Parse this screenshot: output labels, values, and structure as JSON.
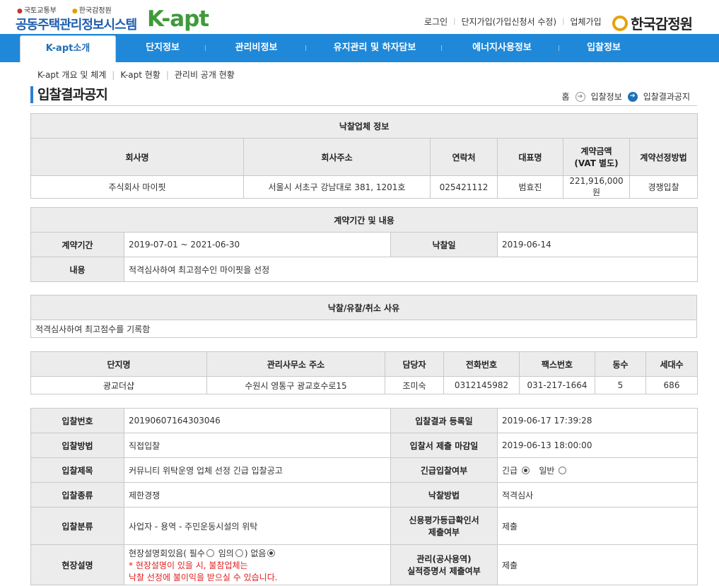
{
  "header": {
    "gov_logo1": "국토교통부",
    "gov_logo2": "한국감정원",
    "system_title": "공동주택관리정보시스템",
    "brand": "K-apt",
    "util_links": [
      "로그인",
      "단지가입(가입신청서 수정)",
      "업체가입"
    ],
    "agency": "한국감정원"
  },
  "nav": {
    "items": [
      "K-apt소개",
      "단지정보",
      "관리비정보",
      "유지관리 및 하자담보",
      "에너지사용정보",
      "입찰정보"
    ]
  },
  "subnav": [
    "K-apt 개요 및 체계",
    "K-apt 현황",
    "관리비 공개 현황"
  ],
  "page": {
    "title": "입찰결과공지",
    "breadcrumb": [
      "홈",
      "입찰정보",
      "입찰결과공지"
    ]
  },
  "winner": {
    "section_title": "낙찰업체 정보",
    "headers": [
      "회사명",
      "회사주소",
      "연락처",
      "대표명",
      "계약금액\n(VAT 별도)",
      "계약선정방법"
    ],
    "header_amount_line1": "계약금액",
    "header_amount_line2": "(VAT 별도)",
    "row": [
      "주식회사 마이핏",
      "서울시 서초구 강남대로 381, 1201호",
      "025421112",
      "범효진",
      "221,916,000원",
      "경쟁입찰"
    ]
  },
  "contract": {
    "section_title": "계약기간 및 내용",
    "period_label": "계약기간",
    "period_value": "2019-07-01 ~ 2021-06-30",
    "award_date_label": "낙찰일",
    "award_date_value": "2019-06-14",
    "content_label": "내용",
    "content_value": "적격심사하여 최고점수인 마이핏을 선정"
  },
  "reason": {
    "section_title": "낙찰/유찰/취소 사유",
    "value": "적격심사하여 최고점수를 기록함"
  },
  "complex": {
    "headers": [
      "단지명",
      "관리사무소 주소",
      "담당자",
      "전화번호",
      "팩스번호",
      "동수",
      "세대수"
    ],
    "row": [
      "광교더샵",
      "수원시 영통구 광교호수로15",
      "조미숙",
      "0312145982",
      "031-217-1664",
      "5",
      "686"
    ]
  },
  "bid": {
    "number_label": "입찰번호",
    "number_value": "20190607164303046",
    "result_date_label": "입찰결과 등록일",
    "result_date_value": "2019-06-17 17:39:28",
    "method_label": "입찰방법",
    "method_value": "직접입찰",
    "deadline_label": "입찰서 제출 마감일",
    "deadline_value": "2019-06-13 18:00:00",
    "subject_label": "입찰제목",
    "subject_value": "커뮤니티 위탁운영 업체 선정 긴급 입찰공고",
    "urgent_label": "긴급입찰여부",
    "urgent_opt1": "긴급",
    "urgent_opt2": "일반",
    "type_label": "입찰종류",
    "type_value": "제한경쟁",
    "award_method_label": "낙찰방법",
    "award_method_value": "적격심사",
    "category_label": "입찰분류",
    "category_value": "사업자 - 용역 - 주민운동시설의 위탁",
    "credit_label_line1": "신용평가등급확인서",
    "credit_label_line2": "제출여부",
    "credit_value": "제출",
    "site_label": "현장설명",
    "site_text1": "현장설명회있음(",
    "site_opt1": "필수",
    "site_opt2": "임의",
    "site_opt3": "없음",
    "site_notice_line1": "* 현장설명이 있을 시, 불참업체는",
    "site_notice_line2": "낙찰 선정에 불이익을 받으실 수 있습니다.",
    "record_label_line1": "관리(공사용역)",
    "record_label_line2": "실적증명서 제출여부",
    "record_value": "제출"
  }
}
